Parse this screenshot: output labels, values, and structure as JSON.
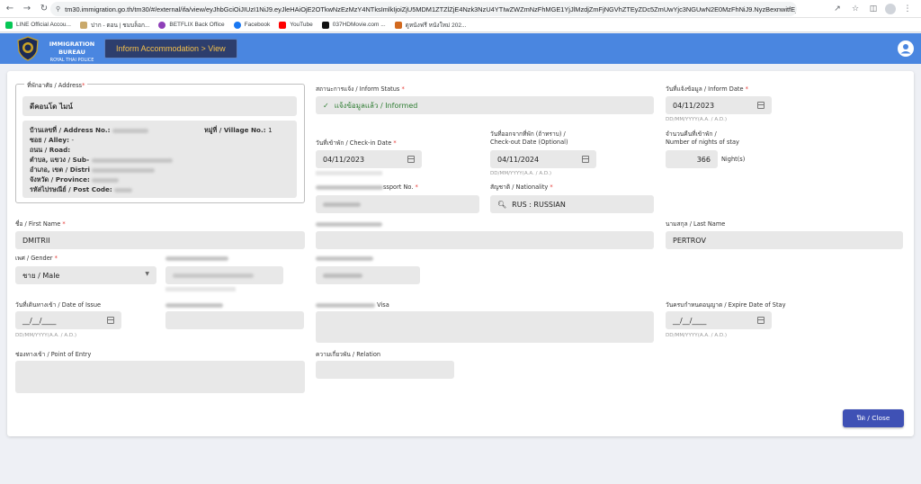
{
  "browser": {
    "url": "tm30.immigration.go.th/tm30/#/external/ifa/view/eyJhbGciOiJIUzI1NiJ9.eyJleHAiOjE2OTkwNzEzMzY4NTksImlkIjoiZjU5MDM1ZTZlZjE4Nzk3NzU4YTIwZWZmNzFhMGE1YjJlMzdjZmFjNGVhZTEyZDc5ZmUwYjc3NGUwN2E0MzFhNiJ9.NyzBexnwitfE_FO-3z8nti...",
    "bookmarks": [
      "LINE Official Accou...",
      "ปาก - ตอน | ชมบล็อก...",
      "BETFLIX Back Office",
      "Facebook",
      "YouTube",
      "037HDMovie.com ...",
      "ดูหนังฟรี หนังใหม่ 202..."
    ]
  },
  "header": {
    "logo_line1": "IMMIGRATION BUREAU",
    "logo_line2": "ROYAL THAI POLICE",
    "breadcrumb": "Inform Accommodation > View",
    "brand_color": "#4a86e0"
  },
  "address": {
    "legend": "ที่พักอาศัย / Address",
    "name": "ดีคอนโด ไมน์",
    "house_no_label": "บ้านเลขที่ / Address No.:",
    "village_label": "หมู่ที่ / Village No.:",
    "village_value": "1",
    "alley_label": "ซอย / Alley:",
    "alley_value": "-",
    "road_label": "ถนน / Road:",
    "subdistrict_label": "ตำบล, แขวง / Sub-",
    "district_label": "อำเภอ, เขต / Distri",
    "province_label": "จังหวัด / Province:",
    "postcode_label": "รหัสไปรษณีย์ / Post Code:"
  },
  "inform_status": {
    "label": "สถานะการแจ้ง / Inform Status",
    "value": "แจ้งข้อมูลแล้ว / Informed",
    "color": "#2e7d32"
  },
  "inform_date": {
    "label": "วันที่แจ้งข้อมูล / Inform Date",
    "value": "04/11/2023",
    "hint": "DD/MM/YYYY(A.A. / A.D.)"
  },
  "checkin": {
    "label": "วันที่เข้าพัก / Check-in Date",
    "value": "04/11/2023"
  },
  "checkout": {
    "label": "วันที่ออกจากที่พัก (ถ้าทราบ) /",
    "label2": "Check-out Date (Optional)",
    "value": "04/11/2024",
    "hint": "DD/MM/YYYY(A.A. / A.D.)"
  },
  "nights": {
    "label": "จำนวนคืนที่เข้าพัก /",
    "label2": "Number of nights of stay",
    "value": "366",
    "unit": "Night(s)"
  },
  "passport": {
    "label_visible": "ssport No."
  },
  "nationality": {
    "label": "สัญชาติ / Nationality",
    "value": "RUS : RUSSIAN"
  },
  "first_name": {
    "label": "ชื่อ / First Name",
    "value": "DMITRII"
  },
  "last_name": {
    "label": "นามสกุล / Last Name",
    "value": "PERTROV"
  },
  "gender": {
    "label": "เพศ / Gender",
    "value": "ชาย / Male"
  },
  "date_of_issue": {
    "label": "วันที่เดินทางเข้า / Date of Issue",
    "value": "__/__/____",
    "hint": "DD/MM/YYYY(A.A. / A.D.)"
  },
  "visa": {
    "label_visible": "Visa"
  },
  "expire_stay": {
    "label": "วันครบกำหนดอนุญาต / Expire Date of Stay",
    "value": "__/__/____",
    "hint": "DD/MM/YYYY(A.A. / A.D.)"
  },
  "point_of_entry": {
    "label": "ช่องทางเข้า / Point of Entry"
  },
  "relation": {
    "label": "ความเกี่ยวพัน / Relation"
  },
  "close_button": {
    "label": "ปิด / Close",
    "color": "#3f51b5"
  }
}
